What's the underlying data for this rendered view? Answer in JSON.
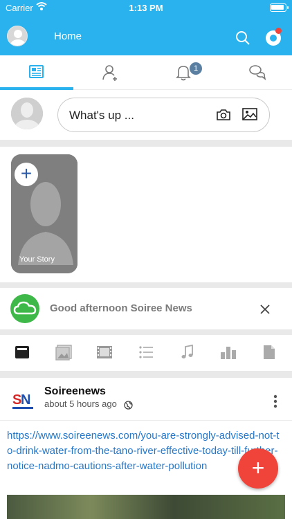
{
  "status_bar": {
    "carrier": "Carrier",
    "time": "1:13 PM"
  },
  "header": {
    "title": "Home"
  },
  "tabs": [
    {
      "name": "news-feed"
    },
    {
      "name": "friend-requests"
    },
    {
      "name": "notifications",
      "badge": "1"
    },
    {
      "name": "messages"
    }
  ],
  "composer": {
    "placeholder": "What's up ..."
  },
  "stories": {
    "add_label": "Your Story"
  },
  "greeting": {
    "text": "Good afternoon Soiree News"
  },
  "post": {
    "author": "Soireenews",
    "time": "about 5 hours ago",
    "link": "https://www.soireenews.com/you-are-strongly-advised-not-to-drink-water-from-the-tano-river-effective-today-till-further-notice-nadmo-cautions-after-water-pollution",
    "logo_text": "SN"
  },
  "colors": {
    "accent": "#29b2ed",
    "fab": "#f0433a",
    "link": "#2577c9",
    "greeting_icon": "#3fb84a"
  }
}
